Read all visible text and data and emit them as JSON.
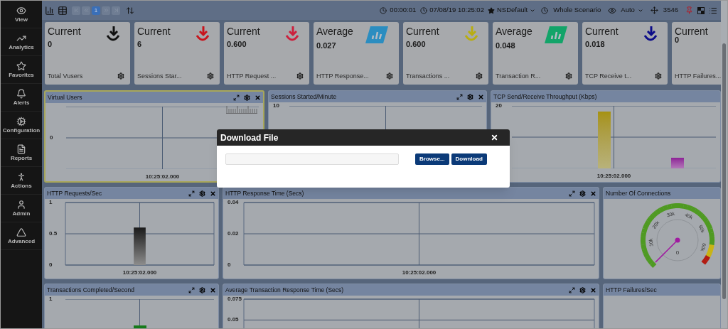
{
  "sidebar": {
    "items": [
      {
        "label": "View"
      },
      {
        "label": "Analytics"
      },
      {
        "label": "Favorites"
      },
      {
        "label": "Alerts"
      },
      {
        "label": "Configuration"
      },
      {
        "label": "Reports"
      },
      {
        "label": "Actions"
      },
      {
        "label": "Admin"
      },
      {
        "label": "Advanced"
      }
    ]
  },
  "toolbar": {
    "pages": [
      {
        "label": "1",
        "selected": true
      }
    ],
    "elapsed": "00:00:01",
    "timestamp": "07/08/19 10:25:02",
    "profile": "NSDefault",
    "range": "Whole Scenario",
    "refresh": "Auto",
    "count": "3546"
  },
  "cards": [
    {
      "stat": "Current",
      "value": "0",
      "label": "Total Vusers",
      "kind": "arrow",
      "color": "#111111"
    },
    {
      "stat": "Current",
      "value": "6",
      "label": "Sessions Star...",
      "kind": "arrow",
      "color": "#c8141c"
    },
    {
      "stat": "Current",
      "value": "0.600",
      "label": "HTTP Request ...",
      "kind": "arrow",
      "color": "#cc1f3c"
    },
    {
      "stat": "Average",
      "value": "0.027",
      "label": "HTTP Response...",
      "kind": "bars",
      "color": "#2b8dc0"
    },
    {
      "stat": "Current",
      "value": "0.600",
      "label": "Transactions ...",
      "kind": "arrow",
      "color": "#b8ad10"
    },
    {
      "stat": "Average",
      "value": "0.048",
      "label": "Transaction R...",
      "kind": "bars",
      "color": "#13a469"
    },
    {
      "stat": "Current",
      "value": "0.018",
      "label": "TCP Receive t...",
      "kind": "arrow",
      "color": "#0c0c88"
    },
    {
      "stat": "Current",
      "value": "0",
      "label": "HTTP Failures...",
      "kind": "none"
    }
  ],
  "panels": [
    {
      "title": "Virtual Users",
      "kind": "trend",
      "tools": true,
      "highlighted": true,
      "y_mid_label": "0",
      "x_label": "10:25:02.000"
    },
    {
      "title": "Sessions Started/Minute",
      "kind": "plot",
      "tools": true,
      "highlighted": false,
      "y_top_label": "10"
    },
    {
      "title": "TCP Send/Receive Throughput (Kbps)",
      "kind": "throughput",
      "tools": false,
      "highlighted": false,
      "y_top_label": "20",
      "x_label": "10:25:02.000"
    },
    {
      "title": "HTTP Requests/Sec",
      "kind": "chart",
      "tools": true,
      "highlighted": false,
      "chart_data": {
        "type": "bar",
        "categories": [
          "10:25:02.000"
        ],
        "series": [
          {
            "color": "#1a1a1a",
            "values": [
              0.6
            ]
          }
        ],
        "ylim": [
          0,
          1
        ],
        "yticks": [
          0,
          0.5,
          1
        ]
      }
    },
    {
      "title": "HTTP Response Time (Secs)",
      "kind": "chart",
      "tools": true,
      "highlighted": false,
      "chart_data": {
        "type": "bar",
        "categories": [
          "10:25:02.000"
        ],
        "series": [
          {
            "color": "#1a1a1a",
            "values": [
              null
            ]
          }
        ],
        "ylim": [
          0,
          0.04
        ],
        "yticks": [
          0,
          0.02,
          0.04
        ]
      }
    },
    {
      "title": "Number Of Connections",
      "kind": "gauge",
      "tools": false,
      "highlighted": false,
      "scale_labels": [
        "10k",
        "20k",
        "30k",
        "40k",
        "50k",
        "60k"
      ],
      "reading": "0"
    },
    {
      "title": "Transactions Completed/Second",
      "kind": "completions",
      "tools": true,
      "highlighted": false,
      "y_top_label": "1"
    },
    {
      "title": "Average Transaction Response Time (Secs)",
      "kind": "chart",
      "tools": true,
      "highlighted": false,
      "chart_data": {
        "type": "bar",
        "series": [
          {
            "color": "#1a1a1a",
            "values": [
              null
            ]
          }
        ],
        "ylim": [
          0,
          0.075
        ],
        "yticks": [
          0.05,
          0.075
        ]
      }
    },
    {
      "title": "HTTP Failures/Sec",
      "kind": "blank",
      "tools": false,
      "highlighted": false
    }
  ],
  "dialog": {
    "title": "Download File",
    "buttons": [
      "Browse...",
      "Download"
    ]
  }
}
